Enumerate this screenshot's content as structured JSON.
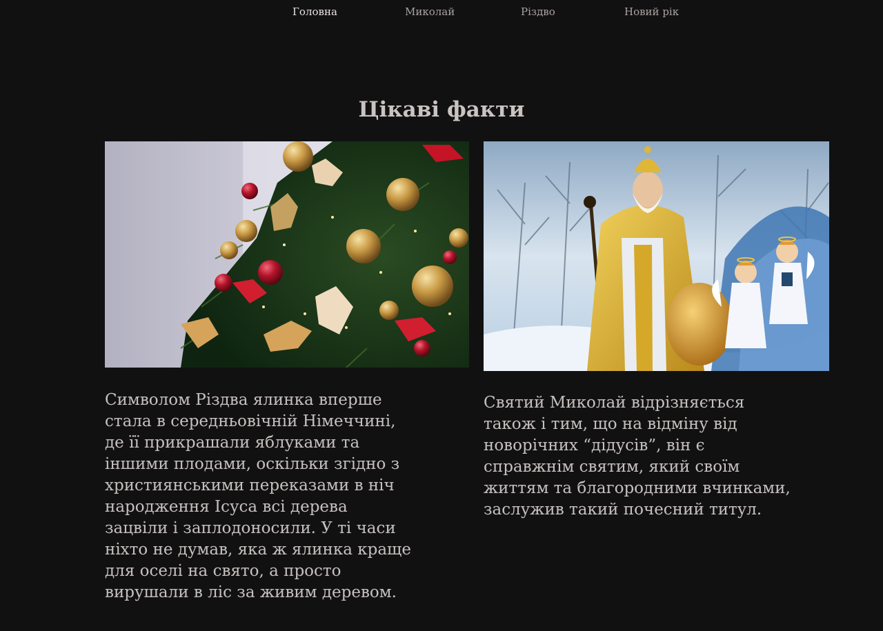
{
  "nav": {
    "items": [
      {
        "label": "Головна",
        "active": true
      },
      {
        "label": "Миколай",
        "active": false
      },
      {
        "label": "Різдво",
        "active": false
      },
      {
        "label": "Новий рік",
        "active": false
      }
    ]
  },
  "main": {
    "title": "Цікаві факти",
    "cards": [
      {
        "image": "christmas-tree-ornaments-image",
        "text": "Символом Різдва ялинка вперше стала в середньовічній Німеччині, де її прикрашали яблуками та іншими плодами, оскільки згідно з християнськими переказами в ніч народження Ісуса всі дерева зацвіли і заплодоносили. У ті часи ніхто не думав, яка ж ялинка краще для оселі на свято, а просто вирушали в ліс за живим деревом."
      },
      {
        "image": "saint-nicholas-with-angels-image",
        "text": "Святий Миколай відрізняється також і тим, що на відміну від новорічних “дідусів”, він є справжнім святим, який своїм життям та благородними вчинками, заслужив такий почесний титул."
      }
    ]
  },
  "colors": {
    "background": "#121112",
    "text": "#c6c1bf",
    "nav_active": "#e9e5e3",
    "nav_inactive": "#a9a4a2"
  }
}
